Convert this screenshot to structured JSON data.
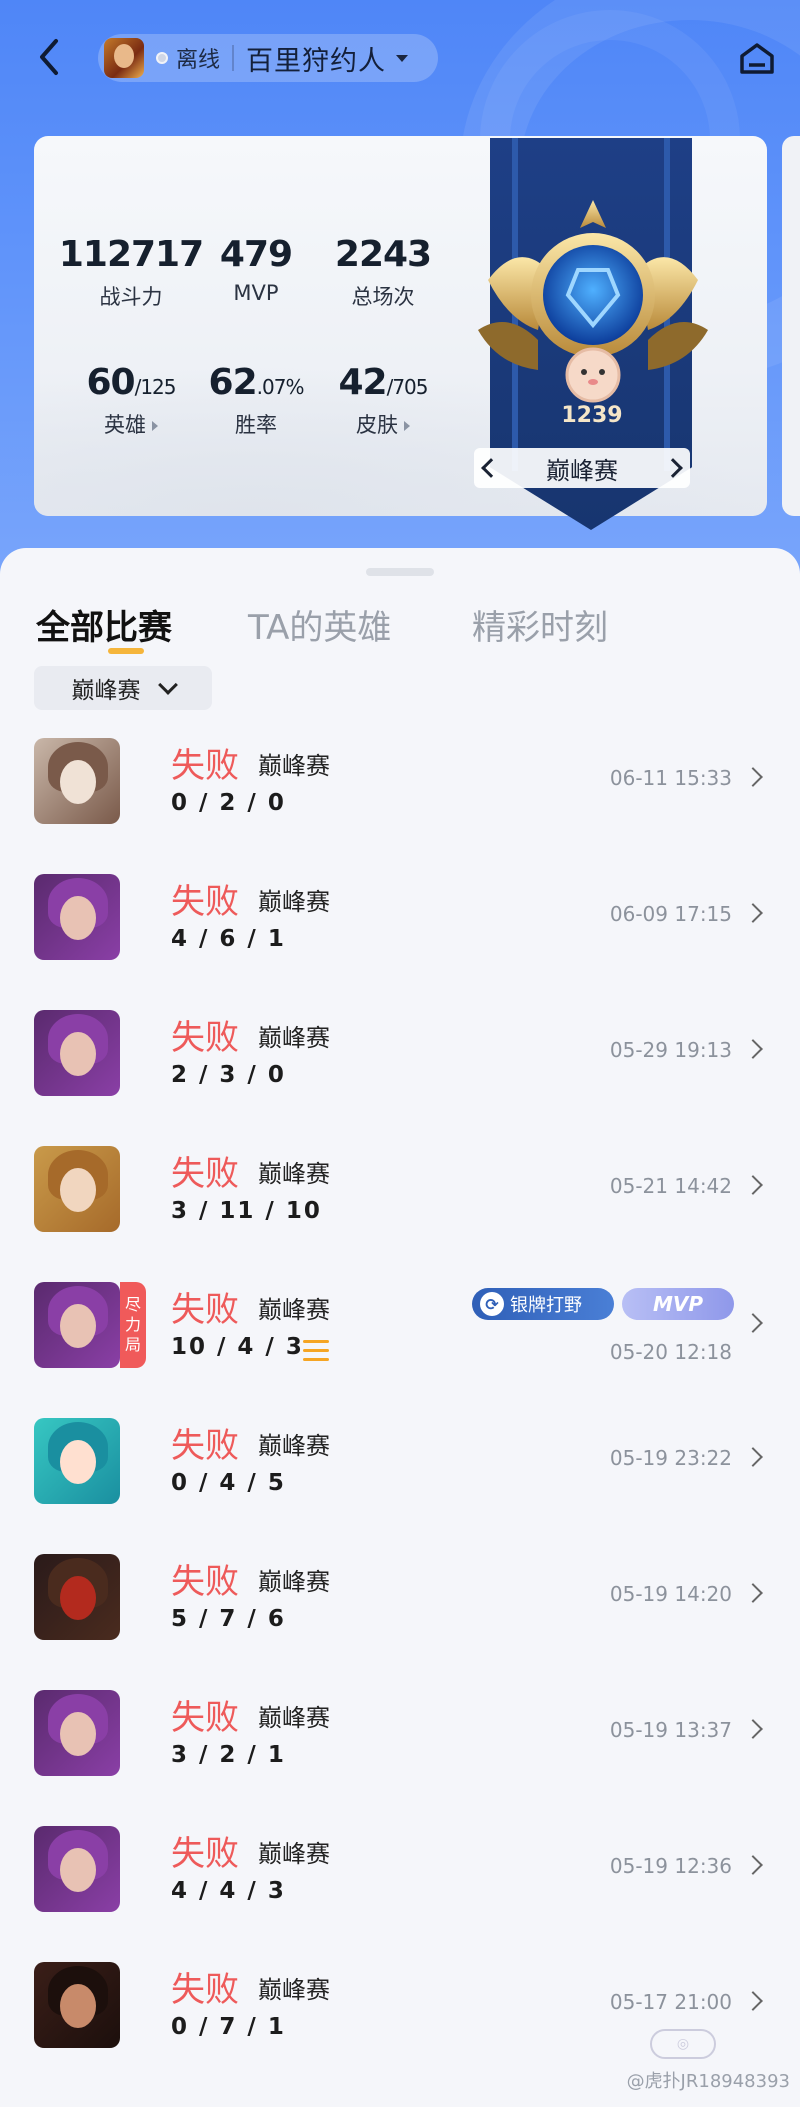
{
  "header": {
    "status": "离线",
    "role_name": "百里狩约人"
  },
  "stats": [
    {
      "value": "112717",
      "label": "战斗力"
    },
    {
      "value": "479",
      "label": "MVP"
    },
    {
      "value": "2243",
      "label": "总场次"
    },
    {
      "value": "60",
      "value_small": "/125",
      "label": "英雄",
      "arrow": true
    },
    {
      "value": "62",
      "value_small": ".07%",
      "label": "胜率",
      "arrow": false
    },
    {
      "value": "42",
      "value_small": "/705",
      "label": "皮肤",
      "arrow": true
    }
  ],
  "rank": {
    "score": "1239",
    "mode": "巅峰赛"
  },
  "tabs": [
    "全部比赛",
    "TA的英雄",
    "精彩时刻"
  ],
  "filter": {
    "label": "巅峰赛"
  },
  "matches": [
    {
      "result": "失败",
      "mode": "巅峰赛",
      "kda": "0 / 2 / 0",
      "time": "06-11 15:33",
      "hero_icon": "hero-silver-hair"
    },
    {
      "result": "失败",
      "mode": "巅峰赛",
      "kda": "4 / 6 / 1",
      "time": "06-09 17:15",
      "hero_icon": "hero-purple-hair"
    },
    {
      "result": "失败",
      "mode": "巅峰赛",
      "kda": "2 / 3 / 0",
      "time": "05-29 19:13",
      "hero_icon": "hero-purple-hair"
    },
    {
      "result": "失败",
      "mode": "巅峰赛",
      "kda": "3 / 11 / 10",
      "time": "05-21 14:42",
      "hero_icon": "hero-blonde-eyepatch"
    },
    {
      "result": "失败",
      "mode": "巅峰赛",
      "kda": "10 / 4 / 3",
      "time": "05-20 12:18",
      "hero_icon": "hero-purple-hair",
      "effort_badge": "尽力局",
      "tag_jungle": "银牌打野",
      "tag_mvp": "MVP"
    },
    {
      "result": "失败",
      "mode": "巅峰赛",
      "kda": "0 / 4 / 5",
      "time": "05-19 23:22",
      "hero_icon": "hero-teal-chibi"
    },
    {
      "result": "失败",
      "mode": "巅峰赛",
      "kda": "5 / 7 / 6",
      "time": "05-19 14:20",
      "hero_icon": "hero-red-mask"
    },
    {
      "result": "失败",
      "mode": "巅峰赛",
      "kda": "3 / 2 / 1",
      "time": "05-19 13:37",
      "hero_icon": "hero-purple-hair"
    },
    {
      "result": "失败",
      "mode": "巅峰赛",
      "kda": "4 / 4 / 3",
      "time": "05-19 12:36",
      "hero_icon": "hero-purple-hair"
    },
    {
      "result": "失败",
      "mode": "巅峰赛",
      "kda": "0 / 7 / 1",
      "time": "05-17 21:00",
      "hero_icon": "hero-dark-warrior"
    }
  ],
  "watermark": "@虎扑JR18948393",
  "colors": {
    "loss": "#ee5a5a",
    "accent": "#f5b53b",
    "header_blue": "#4f86f7"
  }
}
